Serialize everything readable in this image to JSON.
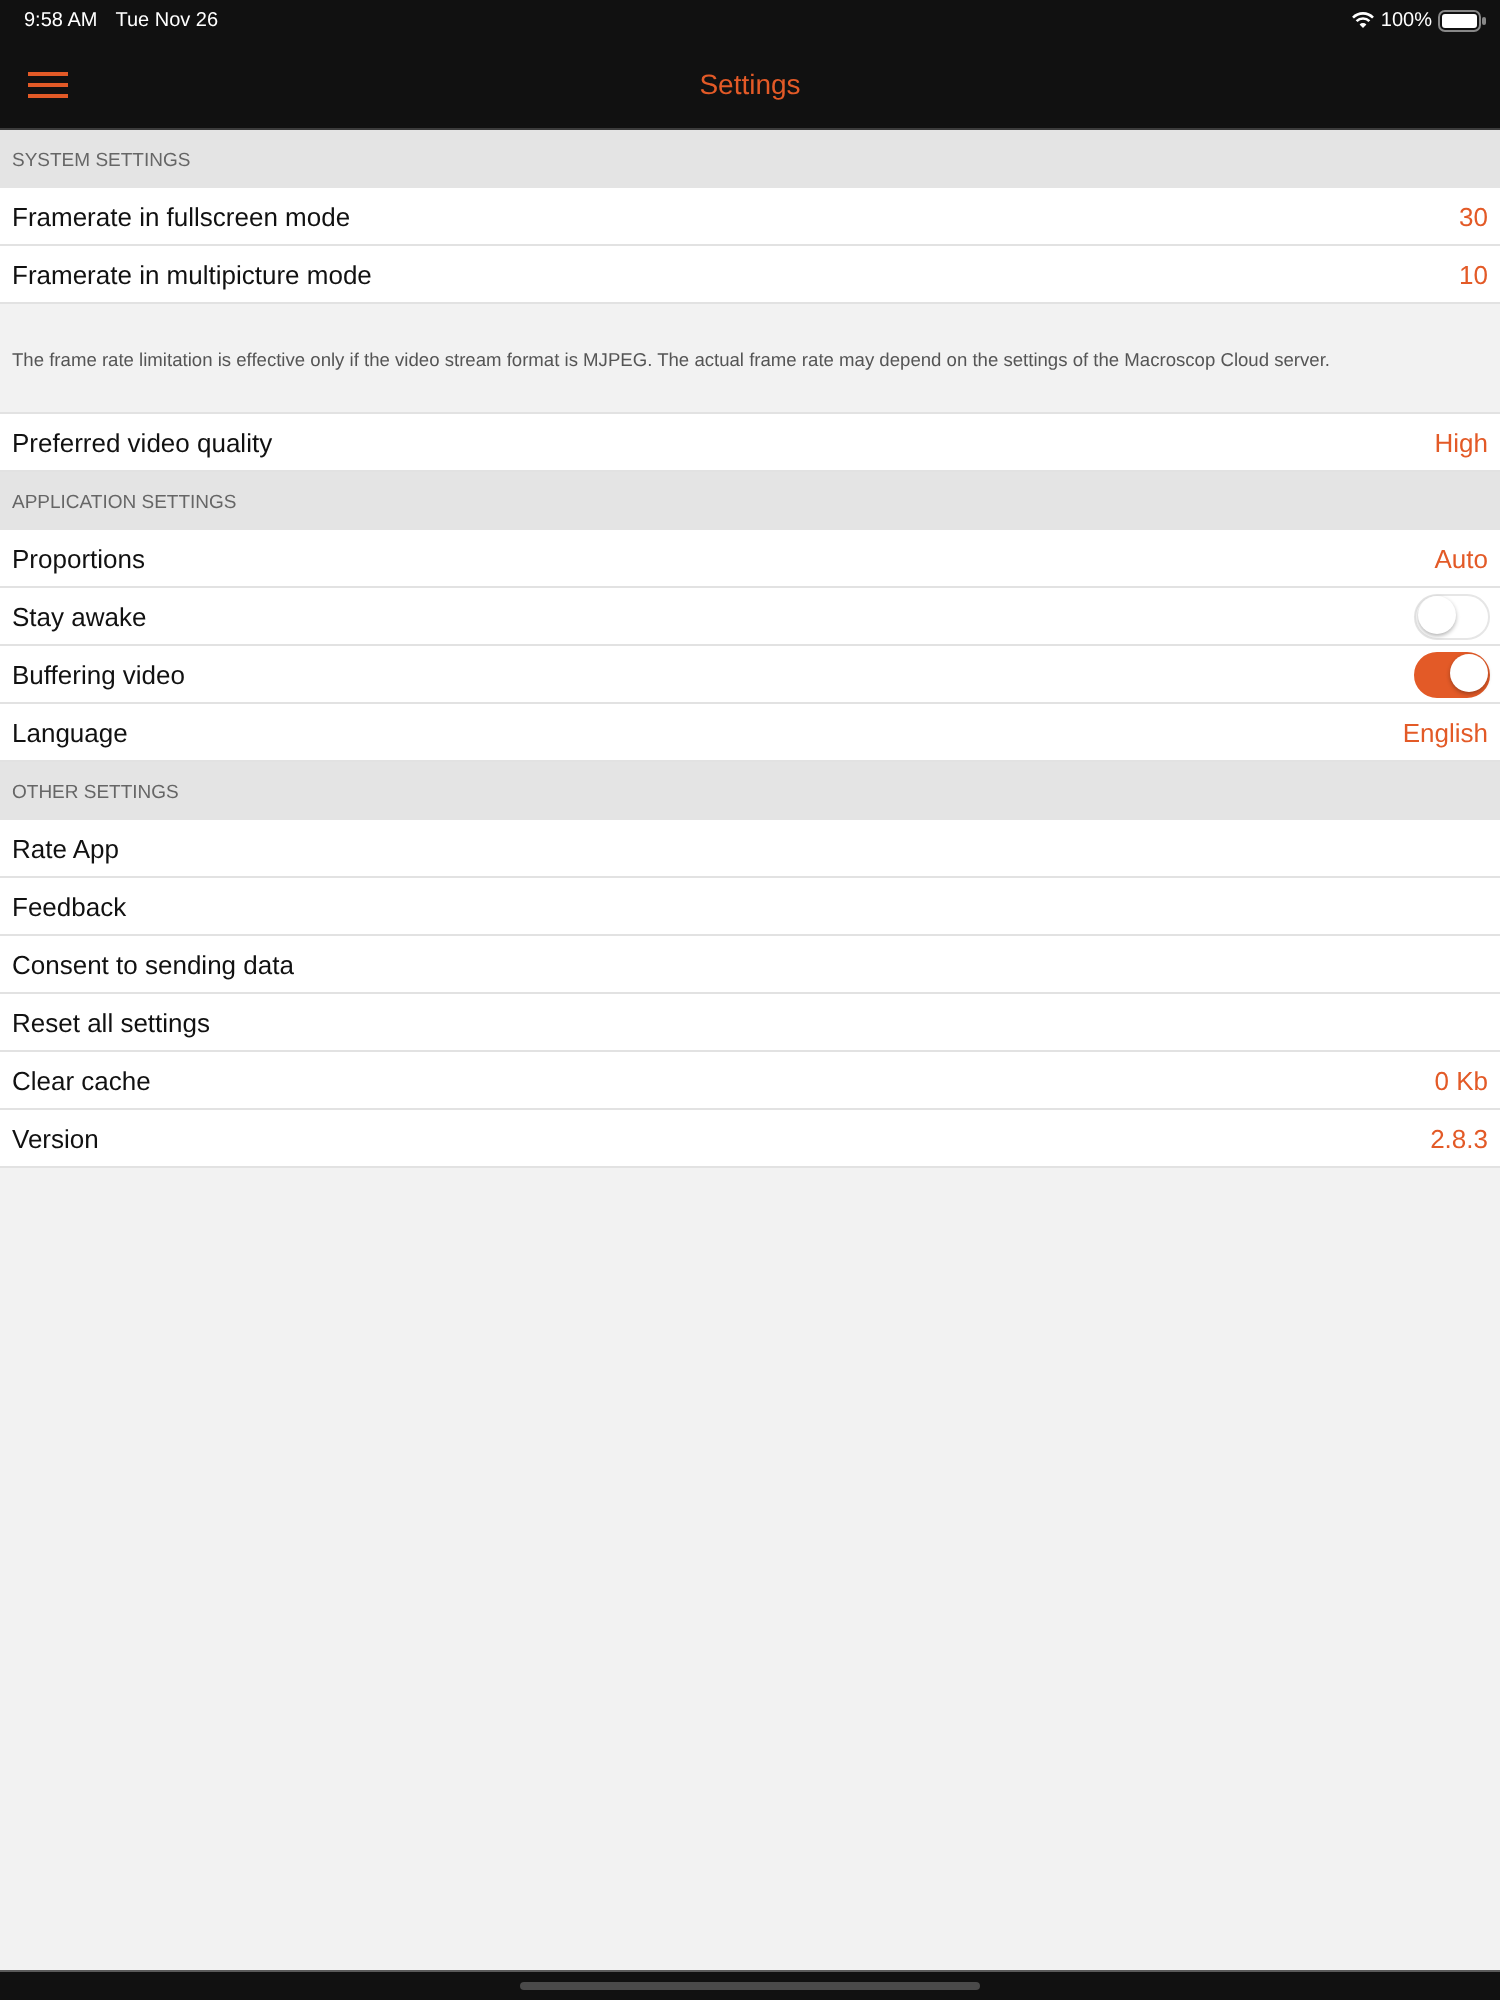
{
  "status_bar": {
    "time": "9:58 AM",
    "date": "Tue Nov 26",
    "battery": "100%"
  },
  "nav_bar": {
    "title": "Settings"
  },
  "sections": [
    {
      "header": "SYSTEM SETTINGS",
      "items": [
        {
          "kind": "value",
          "label": "Framerate in fullscreen mode",
          "value": "30"
        },
        {
          "kind": "value",
          "label": "Framerate in multipicture mode",
          "value": "10"
        },
        {
          "kind": "note",
          "text": "The frame rate limitation is effective only if the video stream format is MJPEG. The actual frame rate may depend on the settings of the Macroscop Cloud server."
        },
        {
          "kind": "value",
          "label": "Preferred video quality",
          "value": "High"
        }
      ]
    },
    {
      "header": "APPLICATION SETTINGS",
      "items": [
        {
          "kind": "value",
          "label": "Proportions",
          "value": "Auto"
        },
        {
          "kind": "switch",
          "label": "Stay awake",
          "on": false
        },
        {
          "kind": "switch",
          "label": "Buffering video",
          "on": true
        },
        {
          "kind": "value",
          "label": "Language",
          "value": "English"
        }
      ]
    },
    {
      "header": "OTHER SETTINGS",
      "items": [
        {
          "kind": "plain",
          "label": "Rate App"
        },
        {
          "kind": "plain",
          "label": "Feedback"
        },
        {
          "kind": "plain",
          "label": "Consent to sending data"
        },
        {
          "kind": "plain",
          "label": "Reset all settings"
        },
        {
          "kind": "value",
          "label": "Clear cache",
          "value": "0 Kb"
        },
        {
          "kind": "value",
          "label": "Version",
          "value": "2.8.3"
        }
      ]
    }
  ]
}
